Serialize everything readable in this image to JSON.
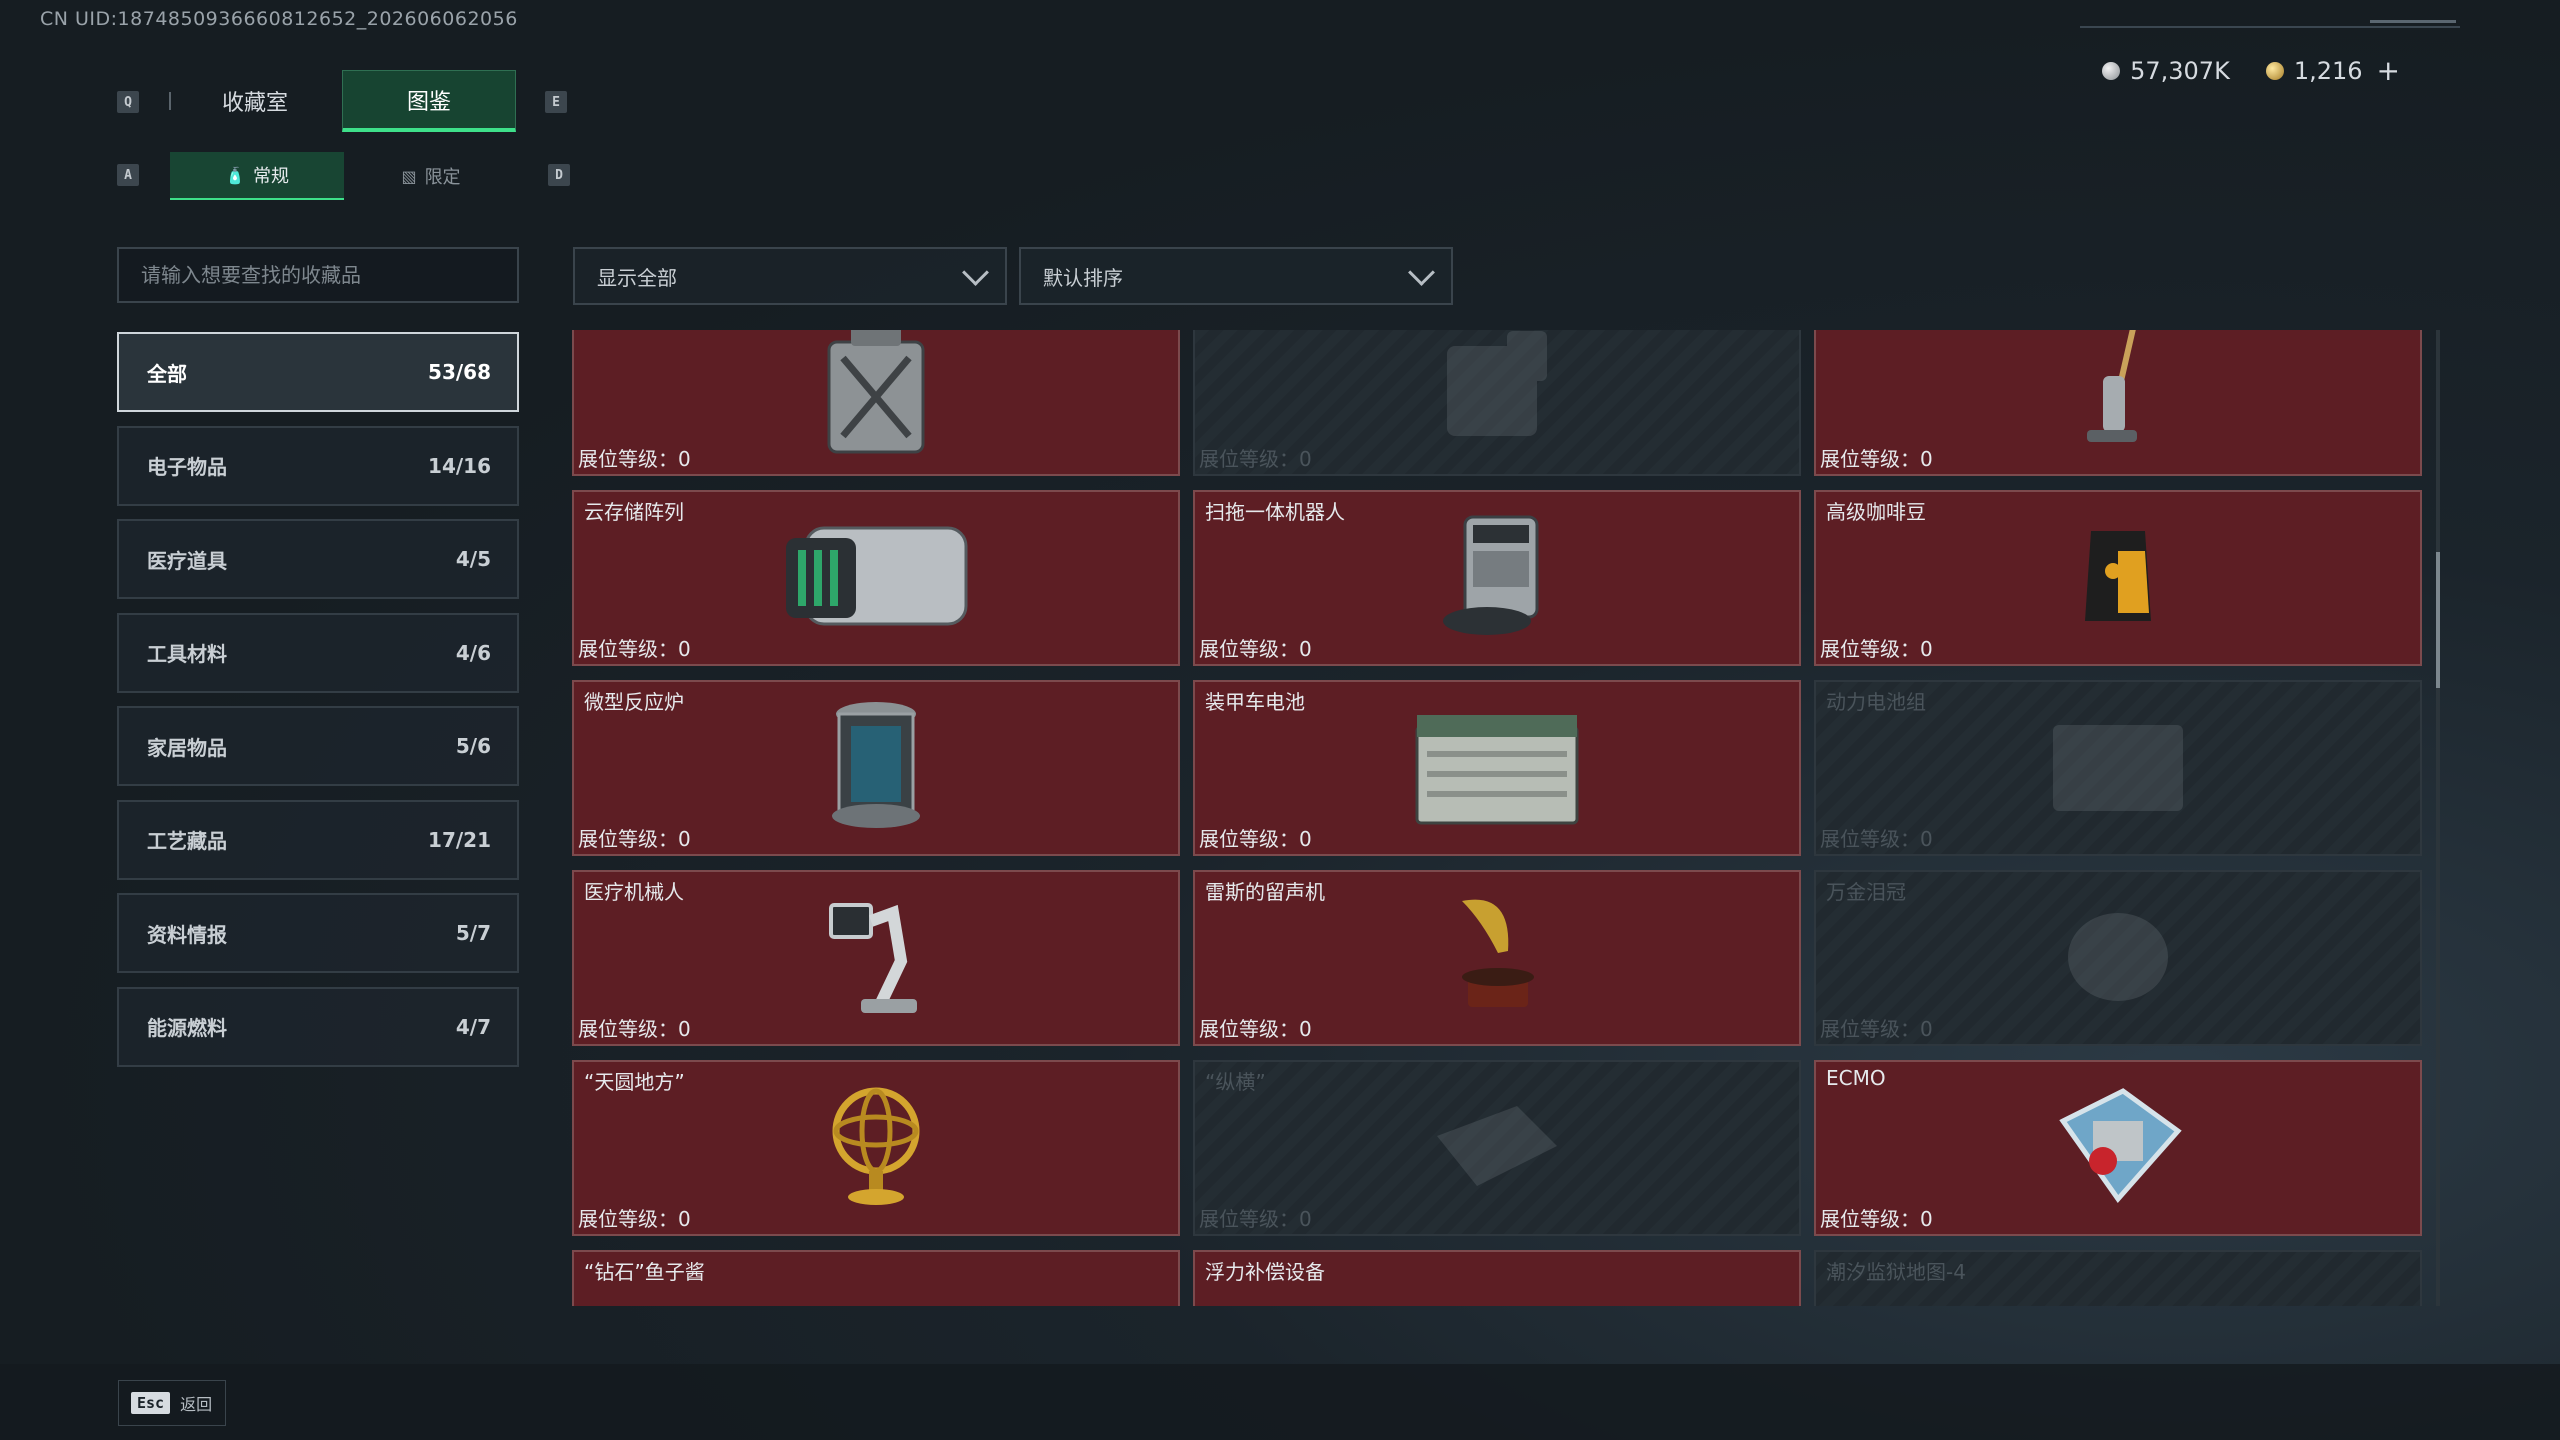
{
  "uid": "CN UID:1874850936660812652_202606062056",
  "currency": {
    "silver": "57,307K",
    "gold": "1,216",
    "plus": "+"
  },
  "keys": {
    "q": "Q",
    "e": "E",
    "a": "A",
    "d": "D",
    "esc": "Esc"
  },
  "tabs": [
    {
      "label": "收藏室"
    },
    {
      "label": "图鉴"
    }
  ],
  "subtabs": [
    {
      "label": "常规",
      "icon": "bottle-icon"
    },
    {
      "label": "限定",
      "icon": "image-icon"
    }
  ],
  "search": {
    "placeholder": "请输入想要查找的收藏品"
  },
  "filters": {
    "show": "显示全部",
    "sort": "默认排序"
  },
  "categories": [
    {
      "name": "全部",
      "count": "53/68"
    },
    {
      "name": "电子物品",
      "count": "14/16"
    },
    {
      "name": "医疗道具",
      "count": "4/5"
    },
    {
      "name": "工具材料",
      "count": "4/6"
    },
    {
      "name": "家居物品",
      "count": "5/6"
    },
    {
      "name": "工艺藏品",
      "count": "17/21"
    },
    {
      "name": "资料情报",
      "count": "5/7"
    },
    {
      "name": "能源燃料",
      "count": "4/7"
    }
  ],
  "items": [
    {
      "name": "",
      "level": "展位等级：0",
      "locked": false,
      "icon": "jerrycan-icon"
    },
    {
      "name": "",
      "level": "展位等级：0",
      "locked": true,
      "icon": "machine-icon"
    },
    {
      "name": "",
      "level": "展位等级：0",
      "locked": false,
      "icon": "vacuum-icon"
    },
    {
      "name": "云存储阵列",
      "level": "展位等级：0",
      "locked": false,
      "icon": "storage-array-icon"
    },
    {
      "name": "扫拖一体机器人",
      "level": "展位等级：0",
      "locked": false,
      "icon": "robot-vacuum-icon"
    },
    {
      "name": "高级咖啡豆",
      "level": "展位等级：0",
      "locked": false,
      "icon": "coffee-bag-icon"
    },
    {
      "name": "微型反应炉",
      "level": "展位等级：0",
      "locked": false,
      "icon": "reactor-icon"
    },
    {
      "name": "装甲车电池",
      "level": "展位等级：0",
      "locked": false,
      "icon": "battery-icon"
    },
    {
      "name": "动力电池组",
      "level": "展位等级：0",
      "locked": true,
      "icon": "battery-pack-icon"
    },
    {
      "name": "医疗机械人",
      "level": "展位等级：0",
      "locked": false,
      "icon": "medical-robot-icon"
    },
    {
      "name": "雷斯的留声机",
      "level": "展位等级：0",
      "locked": false,
      "icon": "gramophone-icon"
    },
    {
      "name": "万金泪冠",
      "level": "展位等级：0",
      "locked": true,
      "icon": "crown-icon"
    },
    {
      "name": "“天圆地方”",
      "level": "展位等级：0",
      "locked": false,
      "icon": "armillary-icon"
    },
    {
      "name": "“纵横”",
      "level": "展位等级：0",
      "locked": true,
      "icon": "chessboard-icon"
    },
    {
      "name": "ECMO",
      "level": "展位等级：0",
      "locked": false,
      "icon": "ecmo-icon"
    },
    {
      "name": "“钻石”鱼子酱",
      "level": "",
      "locked": false,
      "icon": "caviar-icon"
    },
    {
      "name": "浮力补偿设备",
      "level": "",
      "locked": false,
      "icon": "bcd-icon"
    },
    {
      "name": "潮汐监狱地图-4",
      "level": "",
      "locked": true,
      "icon": "map-icon"
    }
  ],
  "footer": {
    "back": "返回"
  },
  "colors": {
    "accent": "#3ee08a",
    "card_owned": "#5d1e24",
    "card_border": "#7c4a4d"
  }
}
